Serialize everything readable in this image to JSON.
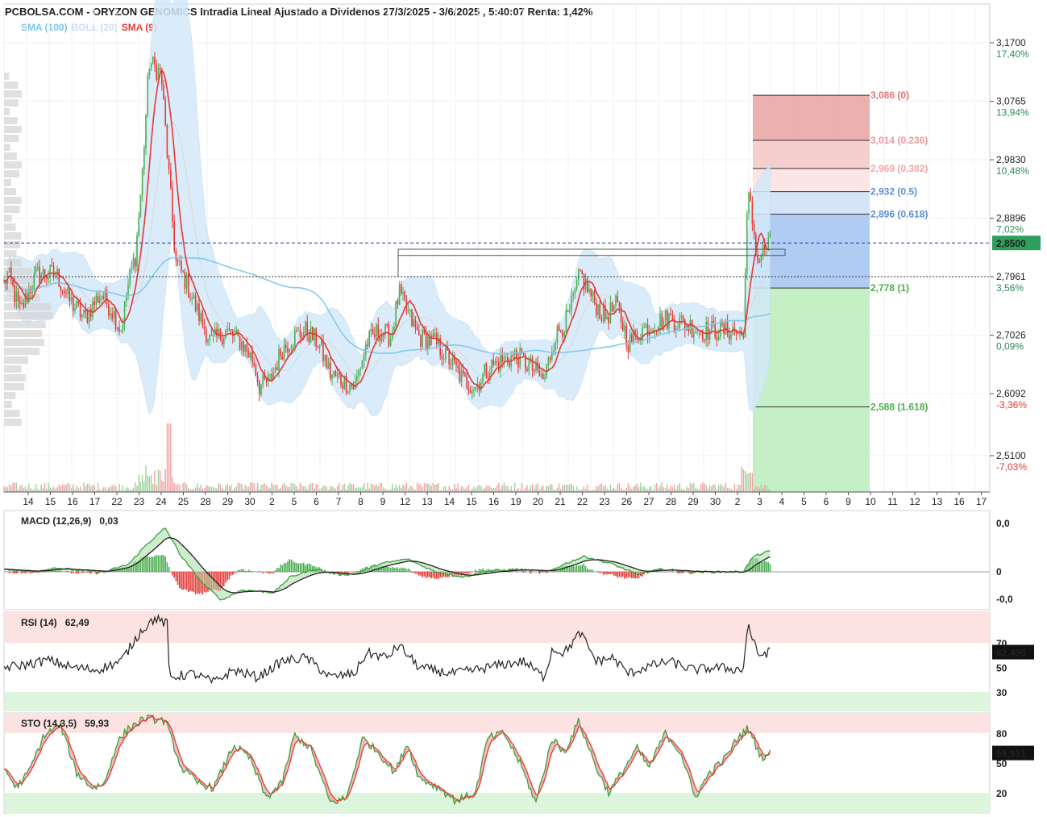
{
  "title": "PCBOLSA.COM - ORYZON GENOMICS Intradia Lineal Ajustado a Dividenos 27/3/2025 - 3/6/2025 , 5:40:07 Renta: 1,42%",
  "legend": [
    {
      "text": "SMA (100)",
      "color": "#7cc4ee"
    },
    {
      "text": "BOLL (20)",
      "color": "#c8def2"
    },
    {
      "text": "SMA (9)",
      "color": "#e53935"
    }
  ],
  "colors": {
    "up": "#4caf50",
    "down": "#e53935",
    "sma9": "#e53935",
    "sma100": "#87c7ee",
    "boll": "#d4e9f8",
    "current_price_bg": "#2e9e5b",
    "dashed_line": "#1f2fbf"
  },
  "chart_data": [
    {
      "type": "candlestick",
      "name": "ORYZON GENOMICS",
      "x_tick_labels": [
        "14",
        "15",
        "16",
        "17",
        "22",
        "23",
        "24",
        "25",
        "28",
        "29",
        "30",
        "2",
        "5",
        "6",
        "7",
        "8",
        "9",
        "12",
        "13",
        "14",
        "15",
        "16",
        "19",
        "20",
        "21",
        "22",
        "23",
        "26",
        "27",
        "28",
        "29",
        "30",
        "2",
        "3",
        "4",
        "5",
        "6",
        "9",
        "10",
        "11",
        "12",
        "13",
        "16",
        "17"
      ],
      "y_ticks": [
        {
          "value": "3,1700",
          "pct": "17,40%",
          "pct_color": "#2e8b57"
        },
        {
          "value": "3,0765",
          "pct": "13,94%",
          "pct_color": "#2e8b57"
        },
        {
          "value": "2,9830",
          "pct": "10,48%",
          "pct_color": "#2e8b57"
        },
        {
          "value": "2,8896",
          "pct": "7,02%",
          "pct_color": "#2e8b57"
        },
        {
          "value": "2,7961",
          "pct": "3,56%",
          "pct_color": "#2e8b57"
        },
        {
          "value": "2,7026",
          "pct": "0,09%",
          "pct_color": "#2e8b57"
        },
        {
          "value": "2,6092",
          "pct": "-3,36%",
          "pct_color": "#e53935"
        },
        {
          "value": "2,5100",
          "pct": "-7,03%",
          "pct_color": "#e53935"
        }
      ],
      "ylim": [
        2.47,
        3.22
      ],
      "current_price": "2,8500",
      "reference_price": 2.7961,
      "fibonacci": [
        {
          "label": "3,086 (0)",
          "value": 3.086,
          "color": "#e57373"
        },
        {
          "label": "3,014 (0.236)",
          "value": 3.014,
          "color": "#ef9a9a"
        },
        {
          "label": "2,969 (0.382)",
          "value": 2.969,
          "color": "#f4a6a6"
        },
        {
          "label": "2,932 (0.5)",
          "value": 2.932,
          "color": "#5b8fd6"
        },
        {
          "label": "2,896 (0.618)",
          "value": 2.896,
          "color": "#5b8fd6"
        },
        {
          "label": "2,778 (1)",
          "value": 2.778,
          "color": "#4caf50"
        },
        {
          "label": "2,588 (1.618)",
          "value": 2.588,
          "color": "#4caf50"
        }
      ],
      "anchors": [
        {
          "x": 0,
          "v": 2.77
        },
        {
          "x": 10,
          "v": 2.8
        },
        {
          "x": 25,
          "v": 2.74
        },
        {
          "x": 45,
          "v": 2.8
        },
        {
          "x": 70,
          "v": 2.8
        },
        {
          "x": 85,
          "v": 2.76
        },
        {
          "x": 105,
          "v": 2.73
        },
        {
          "x": 125,
          "v": 2.77
        },
        {
          "x": 140,
          "v": 2.74
        },
        {
          "x": 150,
          "v": 2.71
        },
        {
          "x": 160,
          "v": 2.79
        },
        {
          "x": 168,
          "v": 2.83
        },
        {
          "x": 176,
          "v": 2.95
        },
        {
          "x": 185,
          "v": 3.14
        },
        {
          "x": 200,
          "v": 3.12
        },
        {
          "x": 210,
          "v": 2.95
        },
        {
          "x": 218,
          "v": 2.82
        },
        {
          "x": 230,
          "v": 2.79
        },
        {
          "x": 245,
          "v": 2.74
        },
        {
          "x": 262,
          "v": 2.69
        },
        {
          "x": 280,
          "v": 2.71
        },
        {
          "x": 300,
          "v": 2.69
        },
        {
          "x": 315,
          "v": 2.66
        },
        {
          "x": 322,
          "v": 2.62
        },
        {
          "x": 335,
          "v": 2.63
        },
        {
          "x": 350,
          "v": 2.68
        },
        {
          "x": 365,
          "v": 2.7
        },
        {
          "x": 380,
          "v": 2.71
        },
        {
          "x": 395,
          "v": 2.69
        },
        {
          "x": 410,
          "v": 2.64
        },
        {
          "x": 425,
          "v": 2.63
        },
        {
          "x": 440,
          "v": 2.62
        },
        {
          "x": 455,
          "v": 2.69
        },
        {
          "x": 470,
          "v": 2.71
        },
        {
          "x": 485,
          "v": 2.7
        },
        {
          "x": 495,
          "v": 2.77
        },
        {
          "x": 505,
          "v": 2.74
        },
        {
          "x": 520,
          "v": 2.7
        },
        {
          "x": 540,
          "v": 2.69
        },
        {
          "x": 560,
          "v": 2.66
        },
        {
          "x": 575,
          "v": 2.63
        },
        {
          "x": 590,
          "v": 2.62
        },
        {
          "x": 605,
          "v": 2.65
        },
        {
          "x": 620,
          "v": 2.66
        },
        {
          "x": 640,
          "v": 2.67
        },
        {
          "x": 660,
          "v": 2.65
        },
        {
          "x": 675,
          "v": 2.63
        },
        {
          "x": 688,
          "v": 2.7
        },
        {
          "x": 705,
          "v": 2.73
        },
        {
          "x": 720,
          "v": 2.8
        },
        {
          "x": 735,
          "v": 2.76
        },
        {
          "x": 750,
          "v": 2.73
        },
        {
          "x": 765,
          "v": 2.75
        },
        {
          "x": 780,
          "v": 2.69
        },
        {
          "x": 795,
          "v": 2.71
        },
        {
          "x": 810,
          "v": 2.72
        },
        {
          "x": 830,
          "v": 2.73
        },
        {
          "x": 850,
          "v": 2.72
        },
        {
          "x": 870,
          "v": 2.71
        },
        {
          "x": 890,
          "v": 2.71
        },
        {
          "x": 910,
          "v": 2.71
        },
        {
          "x": 922,
          "v": 2.7
        },
        {
          "x": 928,
          "v": 2.93
        },
        {
          "x": 934,
          "v": 2.88
        },
        {
          "x": 940,
          "v": 2.82
        },
        {
          "x": 948,
          "v": 2.84
        },
        {
          "x": 955,
          "v": 2.85
        }
      ],
      "volume_x_start": 5,
      "volume_x_end": 956
    },
    {
      "type": "line",
      "name": "MACD (12,26,9)",
      "label": "MACD (12,26,9)",
      "value": "0,03",
      "y_ticks": [
        {
          "text": "0,0",
          "color": "#e53935"
        },
        {
          "text": "0",
          "color": "#222222"
        },
        {
          "text": "-0,0",
          "color": "#2e8b57"
        }
      ],
      "anchors": [
        {
          "x": 5,
          "v": 0.05
        },
        {
          "x": 40,
          "v": 0.0
        },
        {
          "x": 70,
          "v": 0.08
        },
        {
          "x": 100,
          "v": 0.02
        },
        {
          "x": 130,
          "v": 0.0
        },
        {
          "x": 160,
          "v": 0.15
        },
        {
          "x": 180,
          "v": 0.5
        },
        {
          "x": 205,
          "v": 0.85
        },
        {
          "x": 225,
          "v": 0.3
        },
        {
          "x": 250,
          "v": -0.2
        },
        {
          "x": 275,
          "v": -0.55
        },
        {
          "x": 300,
          "v": -0.35
        },
        {
          "x": 340,
          "v": -0.4
        },
        {
          "x": 360,
          "v": -0.1
        },
        {
          "x": 390,
          "v": 0.05
        },
        {
          "x": 420,
          "v": -0.05
        },
        {
          "x": 440,
          "v": -0.05
        },
        {
          "x": 470,
          "v": 0.15
        },
        {
          "x": 505,
          "v": 0.25
        },
        {
          "x": 540,
          "v": 0.0
        },
        {
          "x": 575,
          "v": -0.1
        },
        {
          "x": 600,
          "v": 0.0
        },
        {
          "x": 640,
          "v": 0.05
        },
        {
          "x": 680,
          "v": 0.0
        },
        {
          "x": 700,
          "v": 0.15
        },
        {
          "x": 725,
          "v": 0.3
        },
        {
          "x": 760,
          "v": 0.15
        },
        {
          "x": 790,
          "v": -0.05
        },
        {
          "x": 820,
          "v": 0.05
        },
        {
          "x": 860,
          "v": 0.0
        },
        {
          "x": 900,
          "v": 0.0
        },
        {
          "x": 922,
          "v": 0.0
        },
        {
          "x": 935,
          "v": 0.3
        },
        {
          "x": 955,
          "v": 0.4
        }
      ]
    },
    {
      "type": "line",
      "name": "RSI (14)",
      "label": "RSI (14)",
      "value": "62,49",
      "current": "62,496",
      "y_ticks": [
        {
          "text": "70",
          "color": "#e53935",
          "v": 70
        },
        {
          "text": "50",
          "color": "#222222",
          "v": 50
        },
        {
          "text": "30",
          "color": "#2e8b57",
          "v": 30
        }
      ],
      "ylim": [
        15,
        95
      ],
      "bands": [
        {
          "from": 70,
          "to": 95,
          "color": "#fde2e2"
        },
        {
          "from": 15,
          "to": 30,
          "color": "#dcf5dc"
        }
      ],
      "anchors": [
        {
          "x": 5,
          "v": 50
        },
        {
          "x": 30,
          "v": 52
        },
        {
          "x": 60,
          "v": 56
        },
        {
          "x": 90,
          "v": 50
        },
        {
          "x": 120,
          "v": 48
        },
        {
          "x": 150,
          "v": 55
        },
        {
          "x": 175,
          "v": 80
        },
        {
          "x": 192,
          "v": 90
        },
        {
          "x": 208,
          "v": 85
        },
        {
          "x": 210,
          "v": 42
        },
        {
          "x": 240,
          "v": 45
        },
        {
          "x": 265,
          "v": 38
        },
        {
          "x": 290,
          "v": 48
        },
        {
          "x": 320,
          "v": 42
        },
        {
          "x": 350,
          "v": 55
        },
        {
          "x": 380,
          "v": 58
        },
        {
          "x": 410,
          "v": 42
        },
        {
          "x": 440,
          "v": 45
        },
        {
          "x": 455,
          "v": 62
        },
        {
          "x": 480,
          "v": 58
        },
        {
          "x": 495,
          "v": 68
        },
        {
          "x": 520,
          "v": 50
        },
        {
          "x": 560,
          "v": 45
        },
        {
          "x": 590,
          "v": 48
        },
        {
          "x": 620,
          "v": 52
        },
        {
          "x": 650,
          "v": 55
        },
        {
          "x": 675,
          "v": 42
        },
        {
          "x": 685,
          "v": 65
        },
        {
          "x": 700,
          "v": 62
        },
        {
          "x": 720,
          "v": 78
        },
        {
          "x": 740,
          "v": 55
        },
        {
          "x": 760,
          "v": 58
        },
        {
          "x": 780,
          "v": 45
        },
        {
          "x": 800,
          "v": 50
        },
        {
          "x": 830,
          "v": 55
        },
        {
          "x": 860,
          "v": 48
        },
        {
          "x": 890,
          "v": 50
        },
        {
          "x": 922,
          "v": 48
        },
        {
          "x": 928,
          "v": 86
        },
        {
          "x": 940,
          "v": 60
        },
        {
          "x": 955,
          "v": 62.5
        }
      ]
    },
    {
      "type": "line",
      "name": "STO (14,3,5)",
      "label": "STO (14,3,5)",
      "value": "59,93",
      "current": "59,931",
      "y_ticks": [
        {
          "text": "80",
          "color": "#e53935",
          "v": 80
        },
        {
          "text": "50",
          "color": "#222222",
          "v": 50
        },
        {
          "text": "20",
          "color": "#2e8b57",
          "v": 20
        }
      ],
      "ylim": [
        0,
        100
      ],
      "bands": [
        {
          "from": 80,
          "to": 100,
          "color": "#fde2e2"
        },
        {
          "from": 0,
          "to": 20,
          "color": "#dcf5dc"
        }
      ],
      "anchors": [
        {
          "x": 5,
          "v": 45
        },
        {
          "x": 20,
          "v": 25
        },
        {
          "x": 35,
          "v": 40
        },
        {
          "x": 55,
          "v": 78
        },
        {
          "x": 75,
          "v": 88
        },
        {
          "x": 95,
          "v": 40
        },
        {
          "x": 115,
          "v": 25
        },
        {
          "x": 130,
          "v": 30
        },
        {
          "x": 145,
          "v": 70
        },
        {
          "x": 160,
          "v": 85
        },
        {
          "x": 180,
          "v": 95
        },
        {
          "x": 205,
          "v": 92
        },
        {
          "x": 225,
          "v": 45
        },
        {
          "x": 245,
          "v": 30
        },
        {
          "x": 265,
          "v": 25
        },
        {
          "x": 290,
          "v": 68
        },
        {
          "x": 310,
          "v": 55
        },
        {
          "x": 330,
          "v": 15
        },
        {
          "x": 350,
          "v": 30
        },
        {
          "x": 365,
          "v": 78
        },
        {
          "x": 385,
          "v": 65
        },
        {
          "x": 410,
          "v": 10
        },
        {
          "x": 430,
          "v": 15
        },
        {
          "x": 450,
          "v": 75
        },
        {
          "x": 470,
          "v": 60
        },
        {
          "x": 490,
          "v": 40
        },
        {
          "x": 505,
          "v": 70
        },
        {
          "x": 520,
          "v": 35
        },
        {
          "x": 545,
          "v": 25
        },
        {
          "x": 565,
          "v": 12
        },
        {
          "x": 590,
          "v": 20
        },
        {
          "x": 605,
          "v": 75
        },
        {
          "x": 625,
          "v": 80
        },
        {
          "x": 645,
          "v": 50
        },
        {
          "x": 665,
          "v": 10
        },
        {
          "x": 685,
          "v": 75
        },
        {
          "x": 700,
          "v": 60
        },
        {
          "x": 718,
          "v": 92
        },
        {
          "x": 740,
          "v": 45
        },
        {
          "x": 755,
          "v": 20
        },
        {
          "x": 775,
          "v": 45
        },
        {
          "x": 790,
          "v": 65
        },
        {
          "x": 805,
          "v": 45
        },
        {
          "x": 825,
          "v": 80
        },
        {
          "x": 845,
          "v": 60
        },
        {
          "x": 862,
          "v": 15
        },
        {
          "x": 880,
          "v": 40
        },
        {
          "x": 900,
          "v": 55
        },
        {
          "x": 915,
          "v": 75
        },
        {
          "x": 928,
          "v": 85
        },
        {
          "x": 945,
          "v": 55
        },
        {
          "x": 955,
          "v": 60
        }
      ]
    }
  ]
}
